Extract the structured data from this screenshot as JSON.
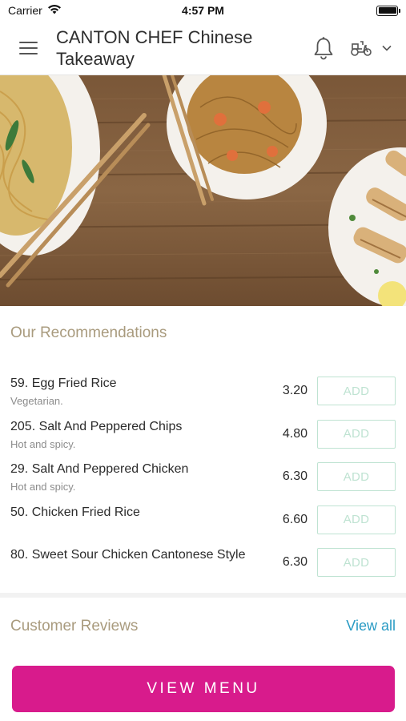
{
  "status_bar": {
    "carrier": "Carrier",
    "time": "4:57 PM"
  },
  "header": {
    "title": "CANTON CHEF Chinese Takeaway",
    "icons": [
      "hamburger-menu-icon",
      "bell-icon",
      "scooter-icon",
      "chevron-down-icon"
    ]
  },
  "hero": {
    "image": "noodle-and-chicken-dishes-on-wooden-table"
  },
  "recommendations": {
    "title": "Our Recommendations",
    "add_label": "ADD",
    "items": [
      {
        "name": "59. Egg Fried Rice",
        "desc": "Vegetarian.",
        "price": "3.20"
      },
      {
        "name": "205. Salt And Peppered Chips",
        "desc": "Hot and spicy.",
        "price": "4.80"
      },
      {
        "name": "29. Salt And Peppered Chicken",
        "desc": "Hot and spicy.",
        "price": "6.30"
      },
      {
        "name": "50. Chicken Fried Rice",
        "desc": "",
        "price": "6.60"
      },
      {
        "name": "80. Sweet Sour Chicken Cantonese Style",
        "desc": "",
        "price": "6.30"
      }
    ]
  },
  "reviews": {
    "title": "Customer Reviews",
    "view_all": "View all"
  },
  "footer": {
    "view_menu": "VIEW MENU"
  },
  "colors": {
    "accent": "#d81b8c",
    "section_title": "#a99b7e",
    "link": "#2a9bc4",
    "add_button": "#bfe3d2"
  }
}
